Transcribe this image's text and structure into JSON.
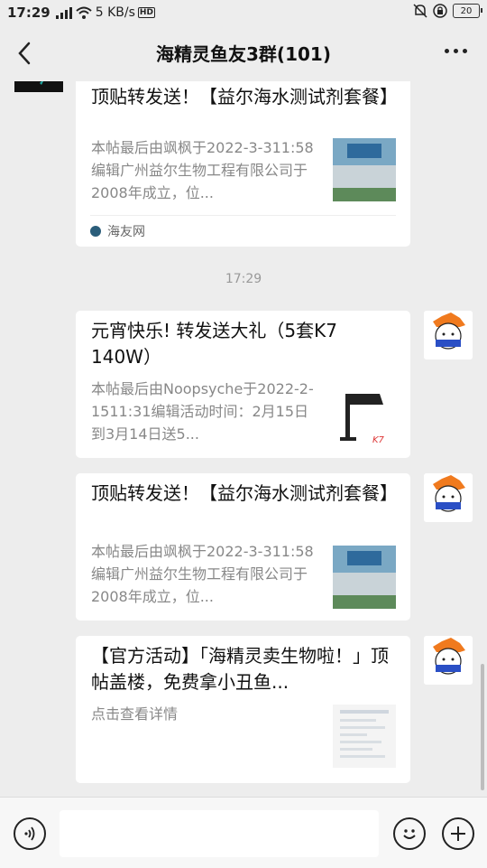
{
  "status_bar": {
    "time": "17:29",
    "signal": "4G",
    "speed": "5 KB/s",
    "hd": "HD",
    "battery": "20"
  },
  "header": {
    "title": "海精灵鱼友3群(101)"
  },
  "messages": [
    {
      "title": "顶贴转发送！【益尔海水测试剂套餐】",
      "desc": "本帖最后由飒枫于2022-3-311:58编辑广州益尔生物工程有限公司于2008年成立，位...",
      "source": "海友网"
    },
    {
      "timestamp": "17:29"
    },
    {
      "title": "元宵快乐! 转发送大礼（5套K7 140W）",
      "desc": "本帖最后由Noopsyche于2022-2-1511:31编辑活动时间：2月15日到3月14日送5..."
    },
    {
      "title": "顶贴转发送！【益尔海水测试剂套餐】",
      "desc": "本帖最后由飒枫于2022-3-311:58编辑广州益尔生物工程有限公司于2008年成立，位..."
    },
    {
      "title": "【官方活动】「海精灵卖生物啦！」顶帖盖楼，免费拿小丑鱼...",
      "desc": "点击查看详情"
    }
  ],
  "input": {
    "placeholder": ""
  },
  "icons": {
    "back": "chevron-left-icon",
    "more": "more-dots-icon",
    "voice": "voice-icon",
    "emoji": "emoji-icon",
    "plus": "plus-icon"
  },
  "colors": {
    "background": "#ededed",
    "card": "#ffffff",
    "muted_text": "#888888"
  }
}
